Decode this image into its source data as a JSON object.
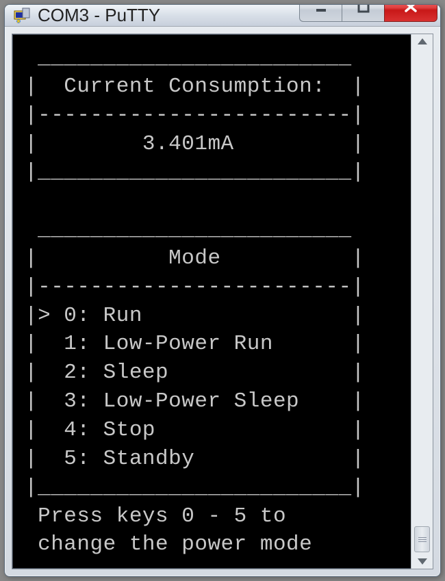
{
  "window": {
    "title": "COM3 - PuTTY"
  },
  "terminal": {
    "box_top": " ________________________",
    "sec1_line1": "|  Current Consumption:  |",
    "sec1_div": "|------------------------|",
    "sec1_val": "|        3.401mA         |",
    "sec1_bot": "|________________________|",
    "blank": "",
    "box_top2": " ________________________",
    "sec2_head": "|          Mode          |",
    "sec2_div": "|------------------------|",
    "m0": "|> 0: Run                |",
    "m1": "|  1: Low-Power Run      |",
    "m2": "|  2: Sleep              |",
    "m3": "|  3: Low-Power Sleep    |",
    "m4": "|  4: Stop               |",
    "m5": "|  5: Standby            |",
    "sec2_bot": "|________________________|",
    "prompt1": " Press keys 0 - 5 to",
    "prompt2": " change the power mode"
  }
}
